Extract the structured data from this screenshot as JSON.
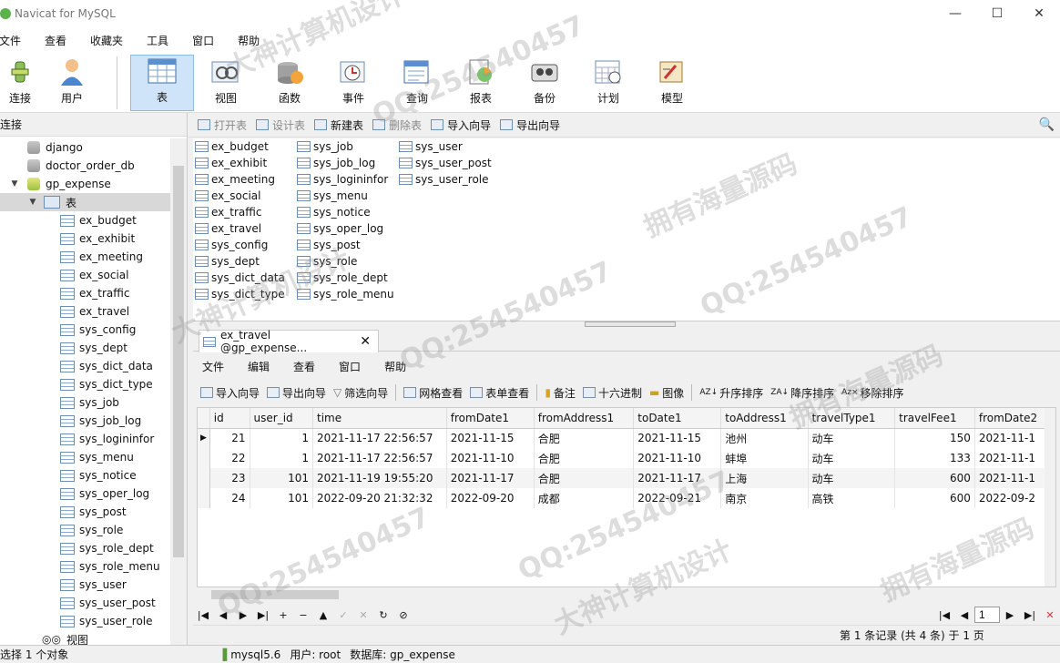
{
  "window": {
    "title": "Navicat for MySQL",
    "buttons": [
      "—",
      "☐",
      "✕"
    ]
  },
  "menu": [
    "文件",
    "查看",
    "收藏夹",
    "工具",
    "窗口",
    "帮助"
  ],
  "toolbar": [
    {
      "label": "连接",
      "icon": "plug-icon"
    },
    {
      "label": "用户",
      "icon": "user-icon"
    },
    {
      "label": "表",
      "icon": "table-icon",
      "active": true
    },
    {
      "label": "视图",
      "icon": "view-icon"
    },
    {
      "label": "函数",
      "icon": "function-icon"
    },
    {
      "label": "事件",
      "icon": "event-icon"
    },
    {
      "label": "查询",
      "icon": "query-icon"
    },
    {
      "label": "报表",
      "icon": "report-icon"
    },
    {
      "label": "备份",
      "icon": "backup-icon"
    },
    {
      "label": "计划",
      "icon": "schedule-icon"
    },
    {
      "label": "模型",
      "icon": "model-icon"
    }
  ],
  "left_pane": {
    "header": "连接",
    "databases": [
      "django",
      "doctor_order_db",
      "gp_expense"
    ],
    "tables_node": "表",
    "tables": [
      "ex_budget",
      "ex_exhibit",
      "ex_meeting",
      "ex_social",
      "ex_traffic",
      "ex_travel",
      "sys_config",
      "sys_dept",
      "sys_dict_data",
      "sys_dict_type",
      "sys_job",
      "sys_job_log",
      "sys_logininfor",
      "sys_menu",
      "sys_notice",
      "sys_oper_log",
      "sys_post",
      "sys_role",
      "sys_role_dept",
      "sys_role_menu",
      "sys_user",
      "sys_user_post",
      "sys_user_role"
    ],
    "views_node": "视图"
  },
  "object_toolbar": [
    "打开表",
    "设计表",
    "新建表",
    "删除表",
    "导入向导",
    "导出向导"
  ],
  "object_list": {
    "col1": [
      "ex_budget",
      "ex_exhibit",
      "ex_meeting",
      "ex_social",
      "ex_traffic",
      "ex_travel",
      "sys_config",
      "sys_dept",
      "sys_dict_data",
      "sys_dict_type"
    ],
    "col2": [
      "sys_job",
      "sys_job_log",
      "sys_logininfor",
      "sys_menu",
      "sys_notice",
      "sys_oper_log",
      "sys_post",
      "sys_role",
      "sys_role_dept",
      "sys_role_menu"
    ],
    "col3": [
      "sys_user",
      "sys_user_post",
      "sys_user_role"
    ]
  },
  "tab": {
    "label": "ex_travel @gp_expense...",
    "close": "✕"
  },
  "inner_menu": [
    "文件",
    "编辑",
    "查看",
    "窗口",
    "帮助"
  ],
  "grid_toolbar": [
    "导入向导",
    "导出向导",
    "筛选向导",
    "网格查看",
    "表单查看",
    "备注",
    "十六进制",
    "图像",
    "升序排序",
    "降序排序",
    "移除排序"
  ],
  "grid": {
    "columns": [
      "id",
      "user_id",
      "time",
      "fromDate1",
      "fromAddress1",
      "toDate1",
      "toAddress1",
      "travelType1",
      "travelFee1",
      "fromDate2"
    ],
    "rows": [
      [
        "21",
        "1",
        "2021-11-17 22:56:57",
        "2021-11-15",
        "合肥",
        "2021-11-15",
        "池州",
        "动车",
        "150",
        "2021-11-1"
      ],
      [
        "22",
        "1",
        "2021-11-17 22:56:57",
        "2021-11-10",
        "合肥",
        "2021-11-10",
        "蚌埠",
        "动车",
        "133",
        "2021-11-1"
      ],
      [
        "23",
        "101",
        "2021-11-19 19:55:20",
        "2021-11-17",
        "合肥",
        "2021-11-17",
        "上海",
        "动车",
        "600",
        "2021-11-1"
      ],
      [
        "24",
        "101",
        "2022-09-20 21:32:32",
        "2022-09-20",
        "成都",
        "2022-09-21",
        "南京",
        "高铁",
        "600",
        "2022-09-2"
      ]
    ]
  },
  "pager": {
    "page": "1"
  },
  "record_info": "第 1 条记录 (共 4 条) 于 1 页",
  "status": {
    "selection": "选择 1 个对象",
    "server": "mysql5.6",
    "user": "用户: root",
    "database": "数据库: gp_expense"
  },
  "watermarks": [
    "QQ:254540457",
    "拥有海量源码",
    "大神计算机设计"
  ]
}
